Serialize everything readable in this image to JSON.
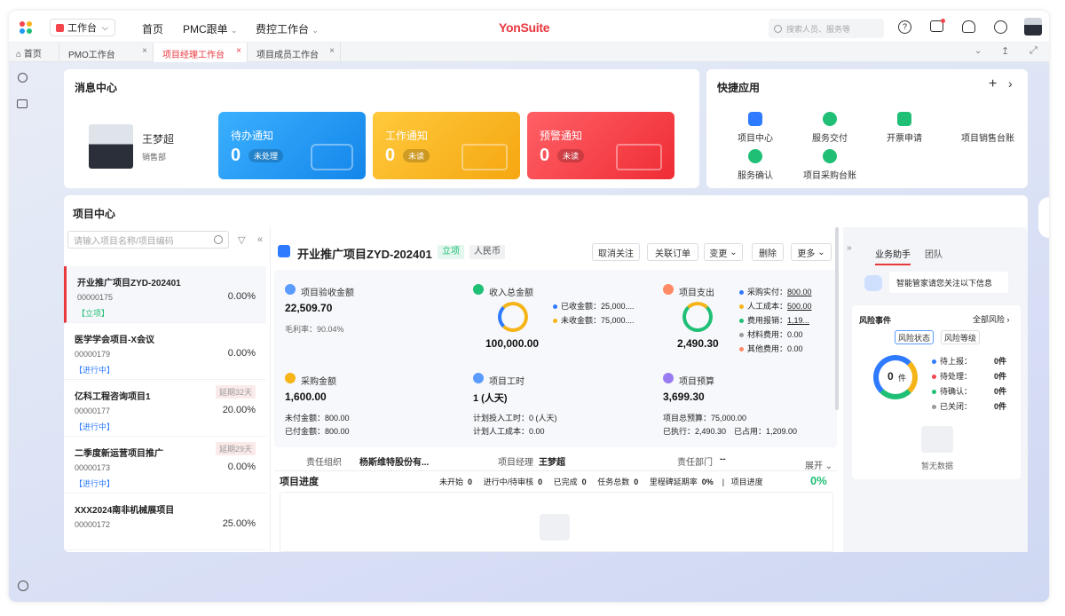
{
  "topbar": {
    "workspace": "工作台",
    "nav": [
      "首页",
      "PMC跟单",
      "费控工作台"
    ],
    "brand": "YonSuite",
    "search_placeholder": "搜索人员、服务等"
  },
  "tabs": [
    {
      "label": "首页"
    },
    {
      "label": "PMO工作台"
    },
    {
      "label": "项目经理工作台"
    },
    {
      "label": "项目成员工作台"
    }
  ],
  "message": {
    "title": "消息中心",
    "user_name": "王梦超",
    "user_dept": "销售部",
    "notices": [
      {
        "title": "待办通知",
        "count": "0",
        "badge": "未处理",
        "color": "#1f9af3"
      },
      {
        "title": "工作通知",
        "count": "0",
        "badge": "未读",
        "color": "#f5b417"
      },
      {
        "title": "预警通知",
        "count": "0",
        "badge": "未读",
        "color": "#f5454c"
      }
    ]
  },
  "quick": {
    "title": "快捷应用",
    "items": [
      "项目中心",
      "服务交付",
      "开票申请",
      "项目销售台账",
      "服务确认",
      "项目采购台账"
    ]
  },
  "project_center": {
    "title": "项目中心",
    "search_placeholder": "请输入项目名称/项目编码",
    "projects": [
      {
        "name": "开业推广项目ZYD-202401",
        "code": "00000175",
        "percent": "0.00%",
        "status": "【立项】",
        "delay": ""
      },
      {
        "name": "医学学会项目-X会议",
        "code": "00000179",
        "percent": "0.00%",
        "status": "【进行中】",
        "delay": ""
      },
      {
        "name": "亿科工程咨询项目1",
        "code": "00000177",
        "percent": "20.00%",
        "status": "【进行中】",
        "delay": "延期32天"
      },
      {
        "name": "二季度新运营项目推广",
        "code": "00000173",
        "percent": "0.00%",
        "status": "【进行中】",
        "delay": "延期29天"
      },
      {
        "name": "XXX2024南非机械展项目",
        "code": "00000172",
        "percent": "25.00%",
        "status": "",
        "delay": ""
      }
    ]
  },
  "detail": {
    "title": "开业推广项目ZYD-202401",
    "status_tag": "立项",
    "currency_tag": "人民币",
    "buttons": [
      "取消关注",
      "关联订单",
      "变更",
      "删除",
      "更多"
    ],
    "acceptance": {
      "label": "项目验收金额",
      "value": "22,509.70",
      "sub": "毛利率：90.04%"
    },
    "income": {
      "label": "收入总金额",
      "value": "100,000.00",
      "items": [
        "已收金额：25,000....",
        "未收金额：75,000...."
      ]
    },
    "expense": {
      "label": "项目支出",
      "value": "2,490.30",
      "items": [
        {
          "label": "采购实付：",
          "value": "800.00"
        },
        {
          "label": "人工成本：",
          "value": "500.00"
        },
        {
          "label": "费用报销：",
          "value": "1,19..."
        },
        {
          "label": "材料费用：",
          "value": "0.00"
        },
        {
          "label": "其他费用：",
          "value": "0.00"
        }
      ]
    },
    "purchase": {
      "label": "采购金额",
      "value": "1,600.00",
      "lines": [
        "未付金额：800.00",
        "已付金额：800.00"
      ]
    },
    "hours": {
      "label": "项目工时",
      "value": "1 (人天)",
      "lines": [
        "计划投入工时：0 (人天)",
        "计划人工成本：0.00"
      ]
    },
    "budget": {
      "label": "项目预算",
      "value": "3,699.30",
      "lines": [
        "项目总预算：75,000.00",
        "已执行：2,490.30",
        "已占用：1,209.00"
      ]
    },
    "info": {
      "org_label": "责任组织",
      "org_value": "杨斯维特股份有...",
      "mgr_label": "项目经理",
      "mgr_value": "王梦超",
      "dept_label": "责任部门",
      "dept_value": "--",
      "expand": "展开"
    },
    "progress": {
      "title": "项目进度",
      "not_started_label": "未开始",
      "not_started": "0",
      "in_progress_label": "进行中/待审核",
      "in_progress": "0",
      "done_label": "已完成",
      "done": "0",
      "total_label": "任务总数",
      "total": "0",
      "delay_label": "里程碑延期率",
      "delay": "0%",
      "progress_label": "项目进度",
      "progress": "0%"
    }
  },
  "assistant": {
    "tabs": [
      "业务助手",
      "团队"
    ],
    "message": "智能管家请您关注以下信息",
    "risk": {
      "title": "风险事件",
      "all": "全部风险",
      "tabs": [
        "风险状态",
        "风险等级"
      ],
      "center": "0",
      "unit": "件",
      "items": [
        {
          "label": "待上报：",
          "value": "0件",
          "color": "#2f7bff"
        },
        {
          "label": "待处理：",
          "value": "0件",
          "color": "#f5454c"
        },
        {
          "label": "待确认：",
          "value": "0件",
          "color": "#1fbf75"
        },
        {
          "label": "已关闭：",
          "value": "0件",
          "color": "#999"
        }
      ],
      "empty": "暂无数据"
    }
  }
}
